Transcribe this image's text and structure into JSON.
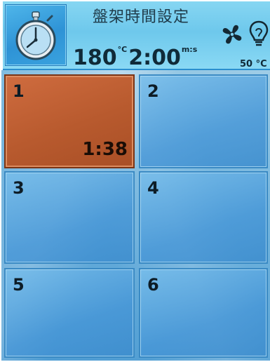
{
  "header": {
    "title": "盤架時間設定",
    "timer_icon": "stopwatch-icon",
    "set_temperature": "180",
    "temperature_unit": "°C",
    "set_time": "2:00",
    "time_unit": "m:s",
    "fan_icon": "fan-icon",
    "light_icon": "light-bulb-icon",
    "oven_temperature": "50 °C"
  },
  "racks": [
    {
      "number": "1",
      "time": "1:38",
      "active": true
    },
    {
      "number": "2",
      "time": "",
      "active": false
    },
    {
      "number": "3",
      "time": "",
      "active": false
    },
    {
      "number": "4",
      "time": "",
      "active": false
    },
    {
      "number": "5",
      "time": "",
      "active": false
    },
    {
      "number": "6",
      "time": "",
      "active": false
    }
  ],
  "colors": {
    "header_bg": "#6ec8ec",
    "active_rack": "#b85a2e",
    "rack_bg": "#4c9bd2"
  }
}
